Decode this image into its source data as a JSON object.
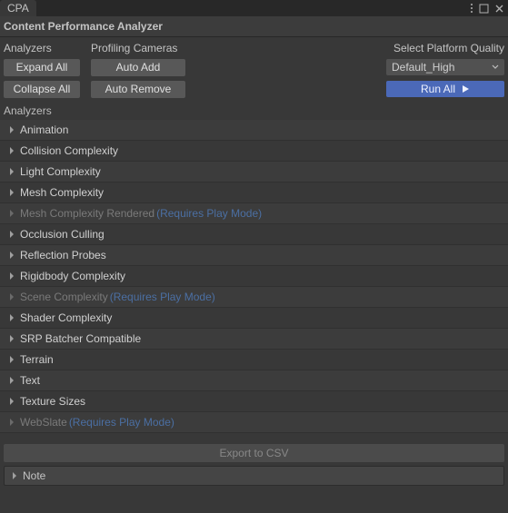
{
  "tab": {
    "label": "CPA"
  },
  "title": "Content Performance Analyzer",
  "headers": {
    "analyzers": "Analyzers",
    "profiling_cameras": "Profiling Cameras",
    "select_platform_quality": "Select Platform Quality"
  },
  "platform_select": {
    "value": "Default_High"
  },
  "buttons": {
    "expand_all": "Expand All",
    "collapse_all": "Collapse All",
    "auto_add": "Auto Add",
    "auto_remove": "Auto Remove",
    "run_all": "Run All",
    "export": "Export to CSV"
  },
  "section_label": "Analyzers",
  "analyzers": [
    {
      "label": "Animation",
      "dim": false,
      "requires": null
    },
    {
      "label": "Collision Complexity",
      "dim": false,
      "requires": null
    },
    {
      "label": "Light Complexity",
      "dim": false,
      "requires": null
    },
    {
      "label": "Mesh Complexity",
      "dim": false,
      "requires": null
    },
    {
      "label": "Mesh Complexity Rendered",
      "dim": true,
      "requires": "(Requires Play Mode)"
    },
    {
      "label": "Occlusion Culling",
      "dim": false,
      "requires": null
    },
    {
      "label": "Reflection Probes",
      "dim": false,
      "requires": null
    },
    {
      "label": "Rigidbody Complexity",
      "dim": false,
      "requires": null
    },
    {
      "label": "Scene Complexity",
      "dim": true,
      "requires": "(Requires Play Mode)"
    },
    {
      "label": "Shader Complexity",
      "dim": false,
      "requires": null
    },
    {
      "label": "SRP Batcher Compatible",
      "dim": false,
      "requires": null
    },
    {
      "label": "Terrain",
      "dim": false,
      "requires": null
    },
    {
      "label": "Text",
      "dim": false,
      "requires": null
    },
    {
      "label": "Texture Sizes",
      "dim": false,
      "requires": null
    },
    {
      "label": "WebSlate",
      "dim": true,
      "requires": "(Requires Play Mode)"
    }
  ],
  "note": {
    "label": "Note"
  }
}
